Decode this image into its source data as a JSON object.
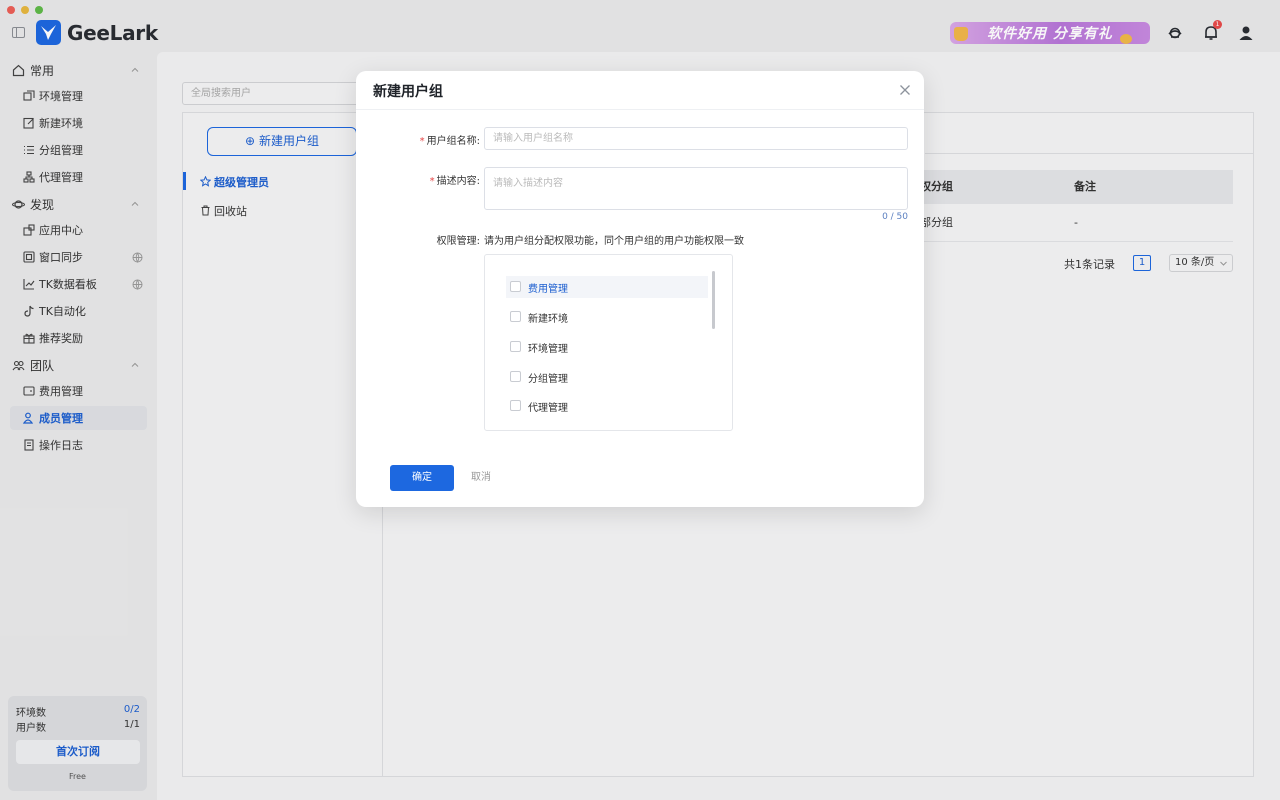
{
  "app": {
    "logo_text": "GeeLark",
    "promo_text": "软件好用 分享有礼",
    "notification_count": "1"
  },
  "sidebar": {
    "groups": [
      {
        "label": "常用",
        "items": [
          {
            "label": "环境管理"
          },
          {
            "label": "新建环境"
          },
          {
            "label": "分组管理"
          },
          {
            "label": "代理管理"
          }
        ]
      },
      {
        "label": "发现",
        "items": [
          {
            "label": "应用中心"
          },
          {
            "label": "窗口同步"
          },
          {
            "label": "TK数据看板"
          },
          {
            "label": "TK自动化"
          },
          {
            "label": "推荐奖励"
          }
        ]
      },
      {
        "label": "团队",
        "items": [
          {
            "label": "费用管理"
          },
          {
            "label": "成员管理"
          },
          {
            "label": "操作日志"
          }
        ]
      }
    ],
    "usage": {
      "env_label": "环境数",
      "env_value": "0/2",
      "user_label": "用户数",
      "user_value": "1/1",
      "subscribe_label": "首次订阅",
      "plan": "Free"
    }
  },
  "main": {
    "search_placeholder": "全局搜索用户",
    "new_group_label": "新建用户组",
    "left_items": [
      {
        "label": "超级管理员"
      },
      {
        "label": "回收站"
      }
    ],
    "table": {
      "columns": [
        "权分组",
        "备注"
      ],
      "rows": [
        [
          "部分组",
          "-"
        ]
      ]
    },
    "pager": {
      "total": "共1条记录",
      "page": "1",
      "size": "10 条/页"
    }
  },
  "modal": {
    "title": "新建用户组",
    "name_label": "用户组名称:",
    "name_placeholder": "请输入用户组名称",
    "desc_label": "描述内容:",
    "desc_placeholder": "请输入描述内容",
    "desc_counter": "0 / 50",
    "perm_label": "权限管理:",
    "perm_hint": "请为用户组分配权限功能，同个用户组的用户功能权限一致",
    "permissions": [
      {
        "label": "费用管理"
      },
      {
        "label": "新建环境"
      },
      {
        "label": "环境管理"
      },
      {
        "label": "分组管理"
      },
      {
        "label": "代理管理"
      }
    ],
    "ok_label": "确定",
    "cancel_label": "取消"
  },
  "colors": {
    "accent": "#1d68e0",
    "required": "#e54545"
  }
}
